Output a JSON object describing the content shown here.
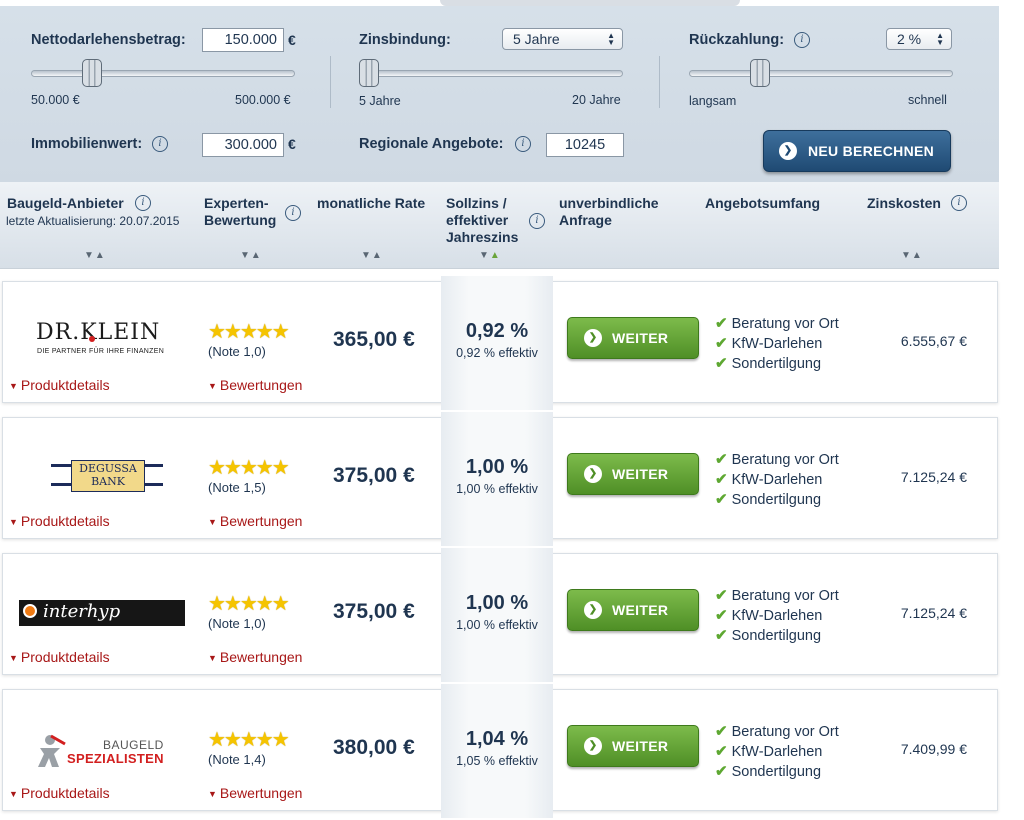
{
  "form": {
    "net_loan": {
      "label": "Nettodarlehensbetrag:",
      "value": "150.000",
      "unit": "€",
      "min": "50.000 €",
      "max": "500.000 €"
    },
    "fixed_rate": {
      "label": "Zinsbindung:",
      "selected": "5 Jahre",
      "min": "5 Jahre",
      "max": "20 Jahre"
    },
    "repayment": {
      "label": "Rückzahlung:",
      "selected": "2 %",
      "min": "langsam",
      "max": "schnell"
    },
    "property_value": {
      "label": "Immobilienwert:",
      "value": "300.000",
      "unit": "€"
    },
    "regional": {
      "label": "Regionale Angebote:",
      "value": "10245"
    },
    "recalc_button": "NEU BERECHNEN",
    "info_glyph": "i"
  },
  "header": {
    "provider": "Baugeld-Anbieter",
    "updated": "letzte Aktualisierung: 20.07.2015",
    "expert_1": "Experten-",
    "expert_2": "Bewertung",
    "monthly": "monatliche Rate",
    "rate_1": "Sollzins /",
    "rate_2": "effektiver",
    "rate_3": "Jahreszins",
    "inquiry_1": "unverbindliche",
    "inquiry_2": "Anfrage",
    "scope": "Angebotsumfang",
    "cost": "Zinskosten"
  },
  "icons": {
    "info": "info-icon",
    "sort": "sort-arrows-icon",
    "arrow": "arrow-right-icon",
    "check": "check-icon",
    "chevron": "double-chevron-down-icon",
    "star": "star-icon"
  },
  "glyphs": {
    "check": "✔",
    "chevron": "❯",
    "dchev": "▼",
    "stars": "★★★★★",
    "sort": "▼▲"
  },
  "colors": {
    "green": "#5ea832",
    "button_blue": "#2a5985",
    "link_red": "#a81818",
    "star": "#f5c400"
  },
  "offers": [
    {
      "provider": "Dr. Klein",
      "logo_main": "DR.KLEIN",
      "logo_sub": "DIE PARTNER FÜR IHRE FINANZEN",
      "rating": "(Note 1,0)",
      "stars": 5,
      "monthly": "365,00 €",
      "rate": "0,92 %",
      "rate_eff": "0,92 % effektiv",
      "button": "WEITER",
      "features": [
        "Beratung vor Ort",
        "KfW-Darlehen",
        "Sondertilgung"
      ],
      "cost": "6.555,67 €",
      "details": "Produktdetails",
      "reviews": "Bewertungen"
    },
    {
      "provider": "Degussa Bank",
      "logo_main": "DEGUSSA",
      "logo_sub": "BANK",
      "rating": "(Note 1,5)",
      "stars": 5,
      "monthly": "375,00 €",
      "rate": "1,00 %",
      "rate_eff": "1,00 % effektiv",
      "button": "WEITER",
      "features": [
        "Beratung vor Ort",
        "KfW-Darlehen",
        "Sondertilgung"
      ],
      "cost": "7.125,24 €",
      "details": "Produktdetails",
      "reviews": "Bewertungen"
    },
    {
      "provider": "Interhyp",
      "logo_main": "interhyp",
      "logo_sub": "",
      "rating": "(Note 1,0)",
      "stars": 5,
      "monthly": "375,00 €",
      "rate": "1,00 %",
      "rate_eff": "1,00 % effektiv",
      "button": "WEITER",
      "features": [
        "Beratung vor Ort",
        "KfW-Darlehen",
        "Sondertilgung"
      ],
      "cost": "7.125,24 €",
      "details": "Produktdetails",
      "reviews": "Bewertungen"
    },
    {
      "provider": "Baugeld Spezialisten",
      "logo_main": "BAUGELD",
      "logo_sub": "SPEZIALISTEN",
      "rating": "(Note 1,4)",
      "stars": 5,
      "monthly": "380,00 €",
      "rate": "1,04 %",
      "rate_eff": "1,05 % effektiv",
      "button": "WEITER",
      "features": [
        "Beratung vor Ort",
        "KfW-Darlehen",
        "Sondertilgung"
      ],
      "cost": "7.409,99 €",
      "details": "Produktdetails",
      "reviews": "Bewertungen"
    }
  ]
}
